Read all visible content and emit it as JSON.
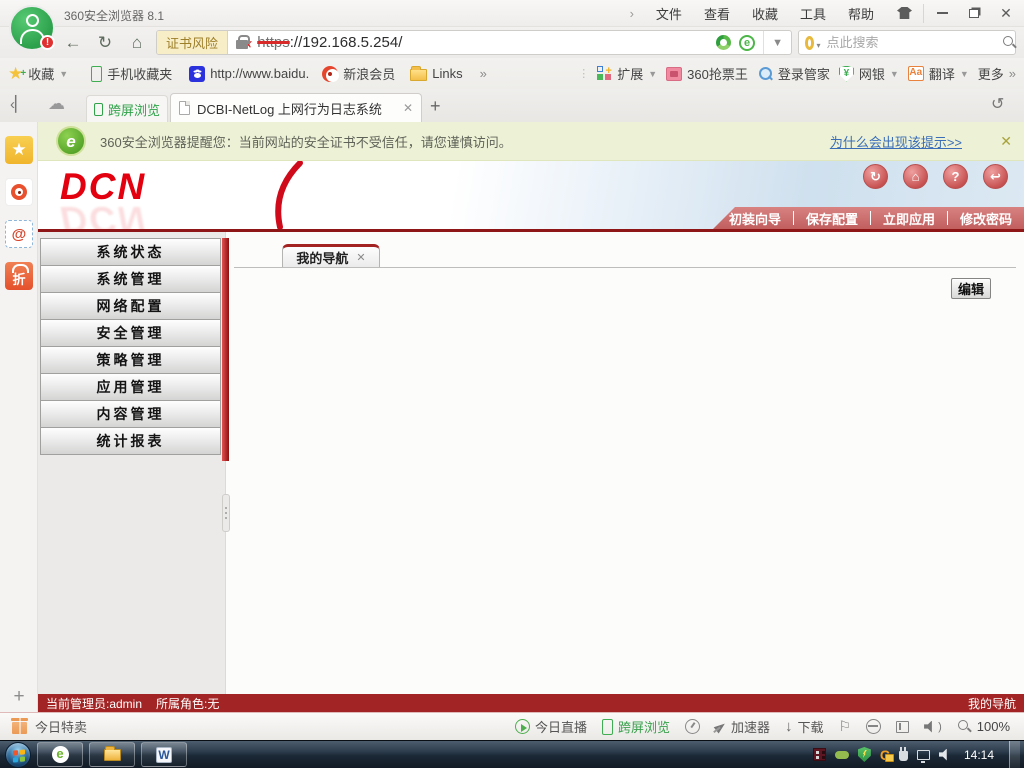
{
  "window": {
    "title": "360安全浏览器 8.1",
    "menus": [
      "文件",
      "查看",
      "收藏",
      "工具",
      "帮助"
    ]
  },
  "address_bar": {
    "cert_badge": "证书风险",
    "protocol": "https",
    "url_suffix": "://192.168.5.254/",
    "search_placeholder": "点此搜索"
  },
  "bookmarks_bar": {
    "favorites_label": "收藏",
    "items": [
      "手机收藏夹",
      "http://www.baidu.",
      "新浪会员",
      "Links"
    ],
    "right_items": [
      "扩展",
      "360抢票王",
      "登录管家",
      "网银",
      "翻译"
    ],
    "more_label": "更多",
    "netbank_icon_text": "¥",
    "translate_icon_text": "Aa"
  },
  "tab_bar": {
    "tab_cross_screen": "跨屏浏览",
    "tab_active": "DCBI-NetLog 上网行为日志系统"
  },
  "side_strip": {
    "discount_icon_text": "折",
    "at_icon_text": "@"
  },
  "warning_bar": {
    "logo_letter": "e",
    "message": "360安全浏览器提醒您：当前网站的安全证书不受信任，请您谨慎访问。",
    "link": "为什么会出现该提示>>"
  },
  "device_ui": {
    "logo": "DCN",
    "top_menu": [
      "初装向导",
      "保存配置",
      "立即应用",
      "修改密码"
    ],
    "header_icons": [
      "refresh",
      "home",
      "help",
      "logout"
    ],
    "sidebar": [
      "系统状态",
      "系统管理",
      "网络配置",
      "安全管理",
      "策略管理",
      "应用管理",
      "内容管理",
      "统计报表"
    ],
    "content_tab": "我的导航",
    "edit_button": "编辑",
    "status_admin": "当前管理员:admin",
    "status_role": "所属角色:无",
    "status_right": "我的导航"
  },
  "bottom_toolbar": {
    "deal_label": "今日特卖",
    "live_label": "今日直播",
    "cross_screen_label": "跨屏浏览",
    "booster_label": "加速器",
    "download_label": "下载",
    "zoom_level": "100%"
  },
  "taskbar": {
    "clock": "14:14",
    "word_icon_text": "W",
    "browser_icon_text": "e"
  },
  "colors": {
    "dcn_red": "#e3000f",
    "menu_bar_red": "#c25e5e",
    "status_bar_red": "#a32424",
    "warning_bg": "#edf2d6",
    "link_blue": "#3a6db8"
  }
}
